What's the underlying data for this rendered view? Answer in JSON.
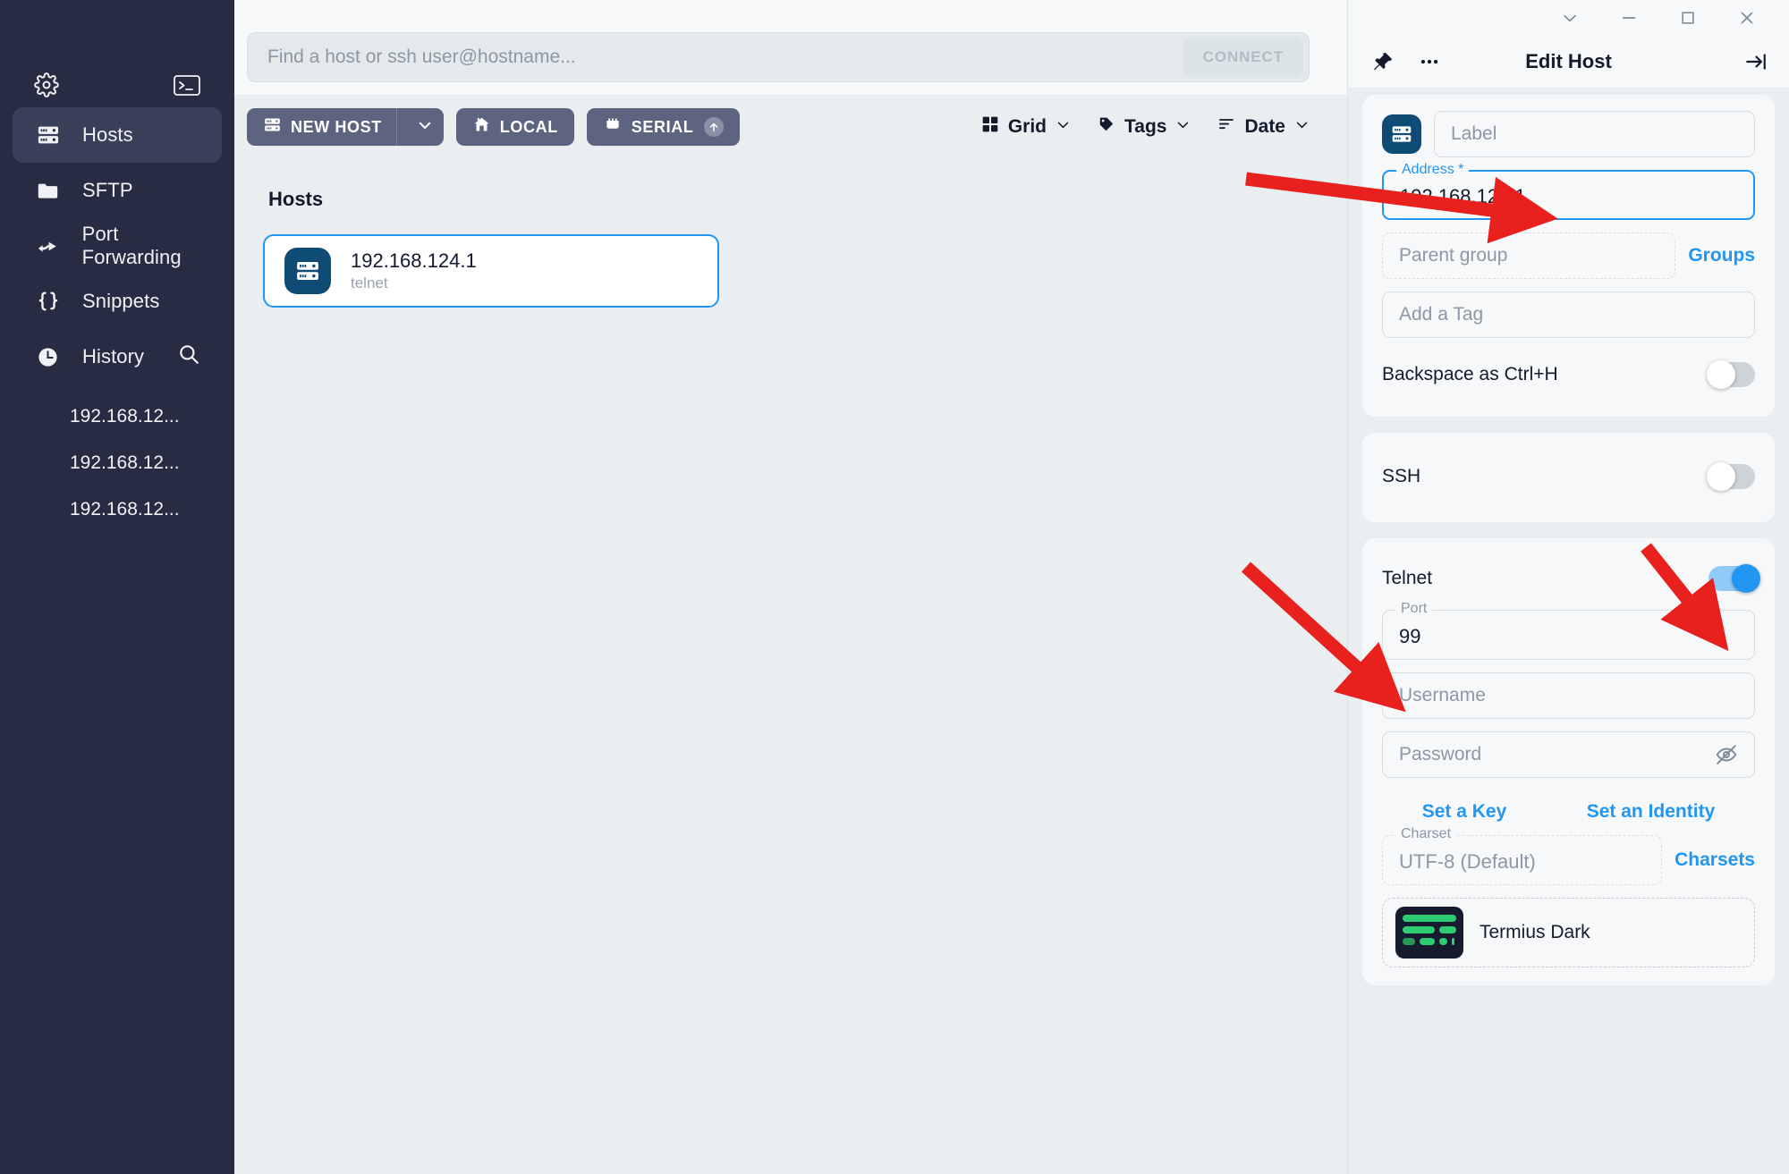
{
  "sidebar": {
    "gear_icon": "gear-icon",
    "terminal_icon": "terminal-icon",
    "items": [
      {
        "label": "Hosts",
        "icon": "server-icon",
        "active": true
      },
      {
        "label": "SFTP",
        "icon": "folder-icon",
        "active": false
      },
      {
        "label": "Port Forwarding",
        "icon": "forward-arrow-icon",
        "active": false
      },
      {
        "label": "Snippets",
        "icon": "braces-icon",
        "active": false
      },
      {
        "label": "History",
        "icon": "clock-icon",
        "active": false
      }
    ],
    "history": [
      {
        "label": "192.168.12..."
      },
      {
        "label": "192.168.12..."
      },
      {
        "label": "192.168.12..."
      }
    ]
  },
  "search": {
    "placeholder": "Find a host or ssh user@hostname...",
    "value": "",
    "connect_label": "CONNECT"
  },
  "toolbar": {
    "new_host_label": "NEW HOST",
    "local_label": "LOCAL",
    "serial_label": "SERIAL",
    "view_label": "Grid",
    "tags_label": "Tags",
    "sort_label": "Date"
  },
  "main": {
    "section_title": "Hosts",
    "hosts": [
      {
        "name": "192.168.124.1",
        "protocol": "telnet",
        "selected": true
      }
    ]
  },
  "panel": {
    "title": "Edit Host",
    "pin_icon": "pin-icon",
    "more_icon": "more-horizontal-icon",
    "collapse_icon": "collapse-right-icon",
    "window": {
      "restore_down": "chevron-down-icon",
      "minimize": "minimize-icon",
      "maximize": "maximize-icon",
      "close": "close-icon"
    },
    "general": {
      "label_placeholder": "Label",
      "label_value": "",
      "address_legend": "Address *",
      "address_value": "192.168.124.1",
      "parent_group_placeholder": "Parent group",
      "groups_link": "Groups",
      "tag_placeholder": "Add a Tag",
      "backspace_label": "Backspace as Ctrl+H",
      "backspace_enabled": false
    },
    "ssh": {
      "label": "SSH",
      "enabled": false
    },
    "telnet": {
      "label": "Telnet",
      "enabled": true,
      "port_legend": "Port",
      "port_value": "99",
      "username_placeholder": "Username",
      "password_placeholder": "Password",
      "set_key_link": "Set a Key",
      "set_identity_link": "Set an Identity",
      "charset_legend": "Charset",
      "charset_value": "UTF-8 (Default)",
      "charsets_link": "Charsets",
      "theme_name": "Termius Dark"
    }
  },
  "colors": {
    "sidebar_bg": "#272c42",
    "accent_blue": "#2196f3",
    "arrow_red": "#e8201e",
    "panel_bg": "#eaeef0",
    "card_bg": "#f7f8fa",
    "host_icon_bg": "#0f4c75",
    "theme_green": "#2ecc71"
  },
  "annotations": [
    {
      "name": "arrow-to-address-field"
    },
    {
      "name": "arrow-to-telnet-toggle"
    },
    {
      "name": "arrow-to-port-field"
    }
  ]
}
